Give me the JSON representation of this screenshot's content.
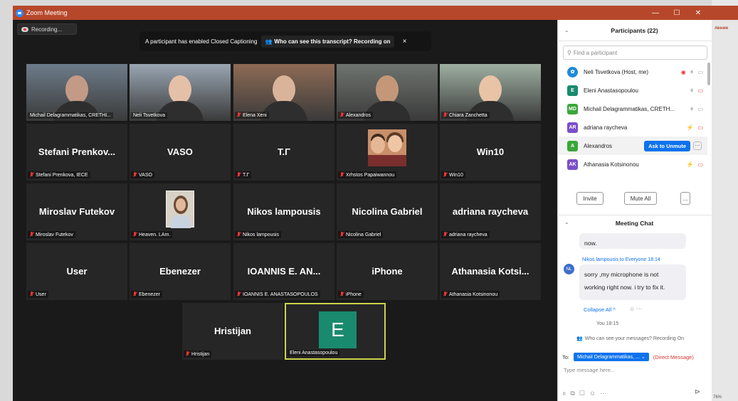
{
  "window": {
    "title": "Zoom Meeting",
    "recording_label": "Recording..."
  },
  "cc_banner": {
    "text": "A participant has enabled Closed Captioning",
    "who_label": "Who can see this transcript? Recording on",
    "close": "×"
  },
  "tiles": [
    {
      "label": "Michail Delagrammatikas, CRETHI...",
      "big": "",
      "kind": "video",
      "muted": false
    },
    {
      "label": "Neli Tsvetkova",
      "big": "",
      "kind": "video",
      "muted": false
    },
    {
      "label": "Elena Xeni",
      "big": "",
      "kind": "video",
      "muted": true
    },
    {
      "label": "Alexandros",
      "big": "",
      "kind": "video",
      "muted": true
    },
    {
      "label": "Chiara Zanchetta",
      "big": "",
      "kind": "video",
      "muted": true
    },
    {
      "label": "Stefani Prenkova, IECE",
      "big": "Stefani Prenkov...",
      "kind": "name",
      "muted": true
    },
    {
      "label": "VASO",
      "big": "VASO",
      "kind": "name",
      "muted": true
    },
    {
      "label": "T.Γ",
      "big": "T.Γ",
      "kind": "name",
      "muted": true
    },
    {
      "label": "Xrhstos Papaiwannou",
      "big": "",
      "kind": "couple",
      "muted": true
    },
    {
      "label": "Win10",
      "big": "Win10",
      "kind": "name",
      "muted": true
    },
    {
      "label": "Miroslav Futekov",
      "big": "Miroslav Futekov",
      "kind": "name",
      "muted": true
    },
    {
      "label": "Heaven. LAm.",
      "big": "",
      "kind": "photo",
      "muted": true
    },
    {
      "label": "Nikos lampousis",
      "big": "Nikos lampousis",
      "kind": "name",
      "muted": true
    },
    {
      "label": "Nicolina Gabriel",
      "big": "Nicolina Gabriel",
      "kind": "name",
      "muted": true
    },
    {
      "label": "adriana raycheva",
      "big": "adriana raycheva",
      "kind": "name",
      "muted": true
    },
    {
      "label": "User",
      "big": "User",
      "kind": "name",
      "muted": true
    },
    {
      "label": "Ebenezer",
      "big": "Ebenezer",
      "kind": "name",
      "muted": true
    },
    {
      "label": "IOANNIS E. ANASTASOPOULOS",
      "big": "IOANNIS E. AN...",
      "kind": "name",
      "muted": true
    },
    {
      "label": "iPhone",
      "big": "iPhone",
      "kind": "name",
      "muted": true
    },
    {
      "label": "Athanasia Kotsinonou",
      "big": "Athanasia Kotsi...",
      "kind": "name",
      "muted": true
    },
    {
      "label": "Hristijan",
      "big": "Hristijan",
      "kind": "name",
      "muted": true
    },
    {
      "label": "Eleni Anastasopoulou",
      "big": "E",
      "kind": "letter",
      "muted": false
    }
  ],
  "participants": {
    "header": "Participants (22)",
    "search_placeholder": "Find a participant",
    "rows": [
      {
        "name": "Neli Tsvetkova (Host, me)",
        "avatar": "",
        "color": "#1f8ad6"
      },
      {
        "name": "Eleni Anastasopoulou",
        "avatar": "E",
        "color": "#1a8a6e"
      },
      {
        "name": "Michail Delagrammatikas, CRETH...",
        "avatar": "MD",
        "color": "#3aa63a"
      },
      {
        "name": "adriana raycheva",
        "avatar": "AR",
        "color": "#7b4fc9"
      },
      {
        "name": "Alexandros",
        "avatar": "A",
        "color": "#3aa63a"
      },
      {
        "name": "Athanasia Kotsinonou",
        "avatar": "AK",
        "color": "#7b4fc9"
      }
    ],
    "ask_to_unmute": "Ask to Unmute",
    "invite": "Invite",
    "mute_all": "Mute All",
    "more": "..."
  },
  "chat": {
    "header": "Meeting Chat",
    "prev_msg": "now.",
    "sender": "Nikos lampousis to Everyone 18:14",
    "avatar": "NL",
    "message": "sorry ,my microphone is not working right now. i try to fix it.",
    "collapse": "Collapse All ^",
    "you_time": "You 18:15",
    "notice": "Who can see your messages? Recording On",
    "to_label": "To:",
    "to_value": "Michail Delagrammatikas, ...",
    "dm_label": "(Direct Message)",
    "placeholder": "Type message here..."
  },
  "background_app": {
    "ribbon_word": "ление",
    "zoom": "76%"
  }
}
